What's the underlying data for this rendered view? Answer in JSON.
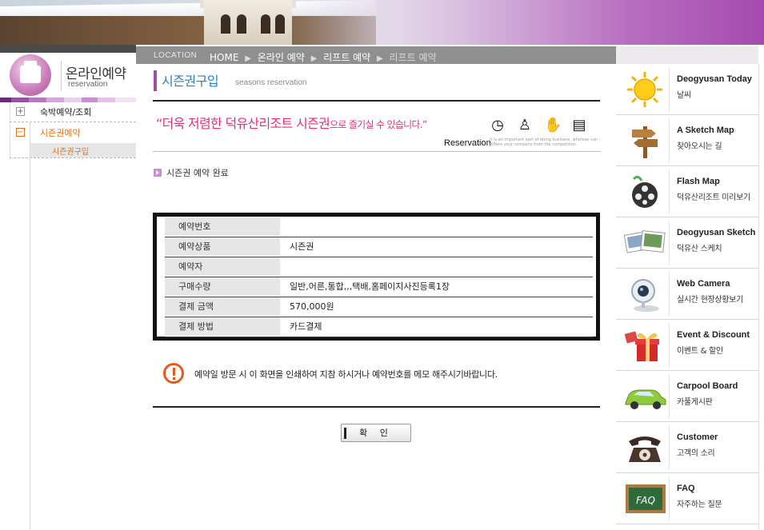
{
  "location": {
    "label": "LOCATION",
    "path": [
      "HOME",
      "온라인 예약",
      "리프트 예약"
    ],
    "current": "리프트 예약"
  },
  "leftnav": {
    "title": "온라인예약",
    "subtitle": "reservation",
    "items": [
      {
        "label": "숙박예약/조회",
        "toggle": "+"
      },
      {
        "label": "시즌권예약",
        "toggle": "−"
      }
    ],
    "subitems": [
      {
        "label": "시즌권구입"
      }
    ]
  },
  "page": {
    "title": "시즌권구입",
    "title_en": "seasons reservation",
    "slogan_main": "“더욱 저렴한 덕유산리조트 시즌권",
    "slogan_tail": "으로 즐기실 수 있습니다.”",
    "reservation_label": "Reservation",
    "reservation_note": "It is an important part of doing business, whereas can differe your company from the competition.",
    "section_title": "시즌권 예약 완료"
  },
  "details": [
    {
      "key": "예약번호",
      "value": ""
    },
    {
      "key": "예약상품",
      "value": "시즌권"
    },
    {
      "key": "예약자",
      "value": ""
    },
    {
      "key": "구매수량",
      "value": "일반,어른,통합,,,택배,홈페이지사진등록1장"
    },
    {
      "key": "결제 금액",
      "value": "570,000원"
    },
    {
      "key": "결제 방법",
      "value": "카드결제"
    }
  ],
  "notice": "예약일 방문 시 이 화면을 인쇄하여 지참 하시거나 예약번호를 메모 해주시기바랍니다.",
  "confirm_label": "확 인",
  "quick_menu": [
    {
      "title": "Deogyusan Today",
      "sub": "날씨",
      "icon": "sun-icon"
    },
    {
      "title": "A Sketch Map",
      "sub": "찾아오시는 길",
      "icon": "signpost-icon"
    },
    {
      "title": "Flash Map",
      "sub": "덕유산리조트 미리보기",
      "icon": "film-reel-icon"
    },
    {
      "title": "Deogyusan Sketch",
      "sub": "덕유산 스케치",
      "icon": "photos-icon"
    },
    {
      "title": "Web Camera",
      "sub": "실시간 현장상황보기",
      "icon": "webcam-icon"
    },
    {
      "title": "Event & Discount",
      "sub": "이벤트 & 할인",
      "icon": "gift-icon"
    },
    {
      "title": "Carpool Board",
      "sub": "카풀게시판",
      "icon": "car-icon"
    },
    {
      "title": "Customer",
      "sub": "고객의 소리",
      "icon": "telephone-icon"
    },
    {
      "title": "FAQ",
      "sub": "자주하는 질문",
      "icon": "faq-board-icon"
    }
  ],
  "colors": {
    "accent_purple": "#9b4fa7",
    "slogan_pink": "#e4307b",
    "nav_active_orange": "#e2701a",
    "title_blue": "#2b7fbf"
  }
}
